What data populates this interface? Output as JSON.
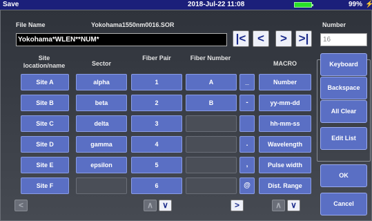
{
  "titlebar": {
    "title": "Save",
    "datetime": "2018-Jul-22 11:08",
    "battery_pct": "99%"
  },
  "file": {
    "name_label": "File Name",
    "name_value": "Yokohama1550nm0016.SOR",
    "input_value": "Yokohama*WLEN**NUM*"
  },
  "number": {
    "label": "Number",
    "value": "16"
  },
  "nav": {
    "first": "|<",
    "prev": "<",
    "next": ">",
    "last": ">|"
  },
  "columns": {
    "site": "Site location/name",
    "sector": "Sector",
    "fiber_pair": "Fiber Pair",
    "fiber_number": "Fiber Number",
    "macro": "MACRO"
  },
  "sites": [
    "Site A",
    "Site B",
    "Site C",
    "Site D",
    "Site E",
    "Site F"
  ],
  "sectors": [
    "alpha",
    "beta",
    "delta",
    "gamma",
    "epsilon",
    ""
  ],
  "fiber_pairs": [
    "1",
    "2",
    "3",
    "4",
    "5",
    "6"
  ],
  "fiber_numbers": [
    "A",
    "B",
    "",
    "",
    "",
    ""
  ],
  "symbols": [
    "_",
    "-",
    "",
    ".",
    ",",
    "@"
  ],
  "macros": [
    "Number",
    "yy-mm-dd",
    "hh-mm-ss",
    "Wavelength",
    "Pulse width",
    "Dist. Range"
  ],
  "right_buttons": {
    "keyboard": "Keyboard",
    "backspace": "Backspace",
    "all_clear": "All Clear",
    "edit_list": "Edit List",
    "ok": "OK",
    "cancel": "Cancel"
  },
  "arrows": {
    "left": "<",
    "up": "^",
    "down": "v",
    "right": ">"
  },
  "colors": {
    "titlebar": "#1b1f7a",
    "button_blue": "#5a6fc4",
    "battery": "#28e028"
  }
}
